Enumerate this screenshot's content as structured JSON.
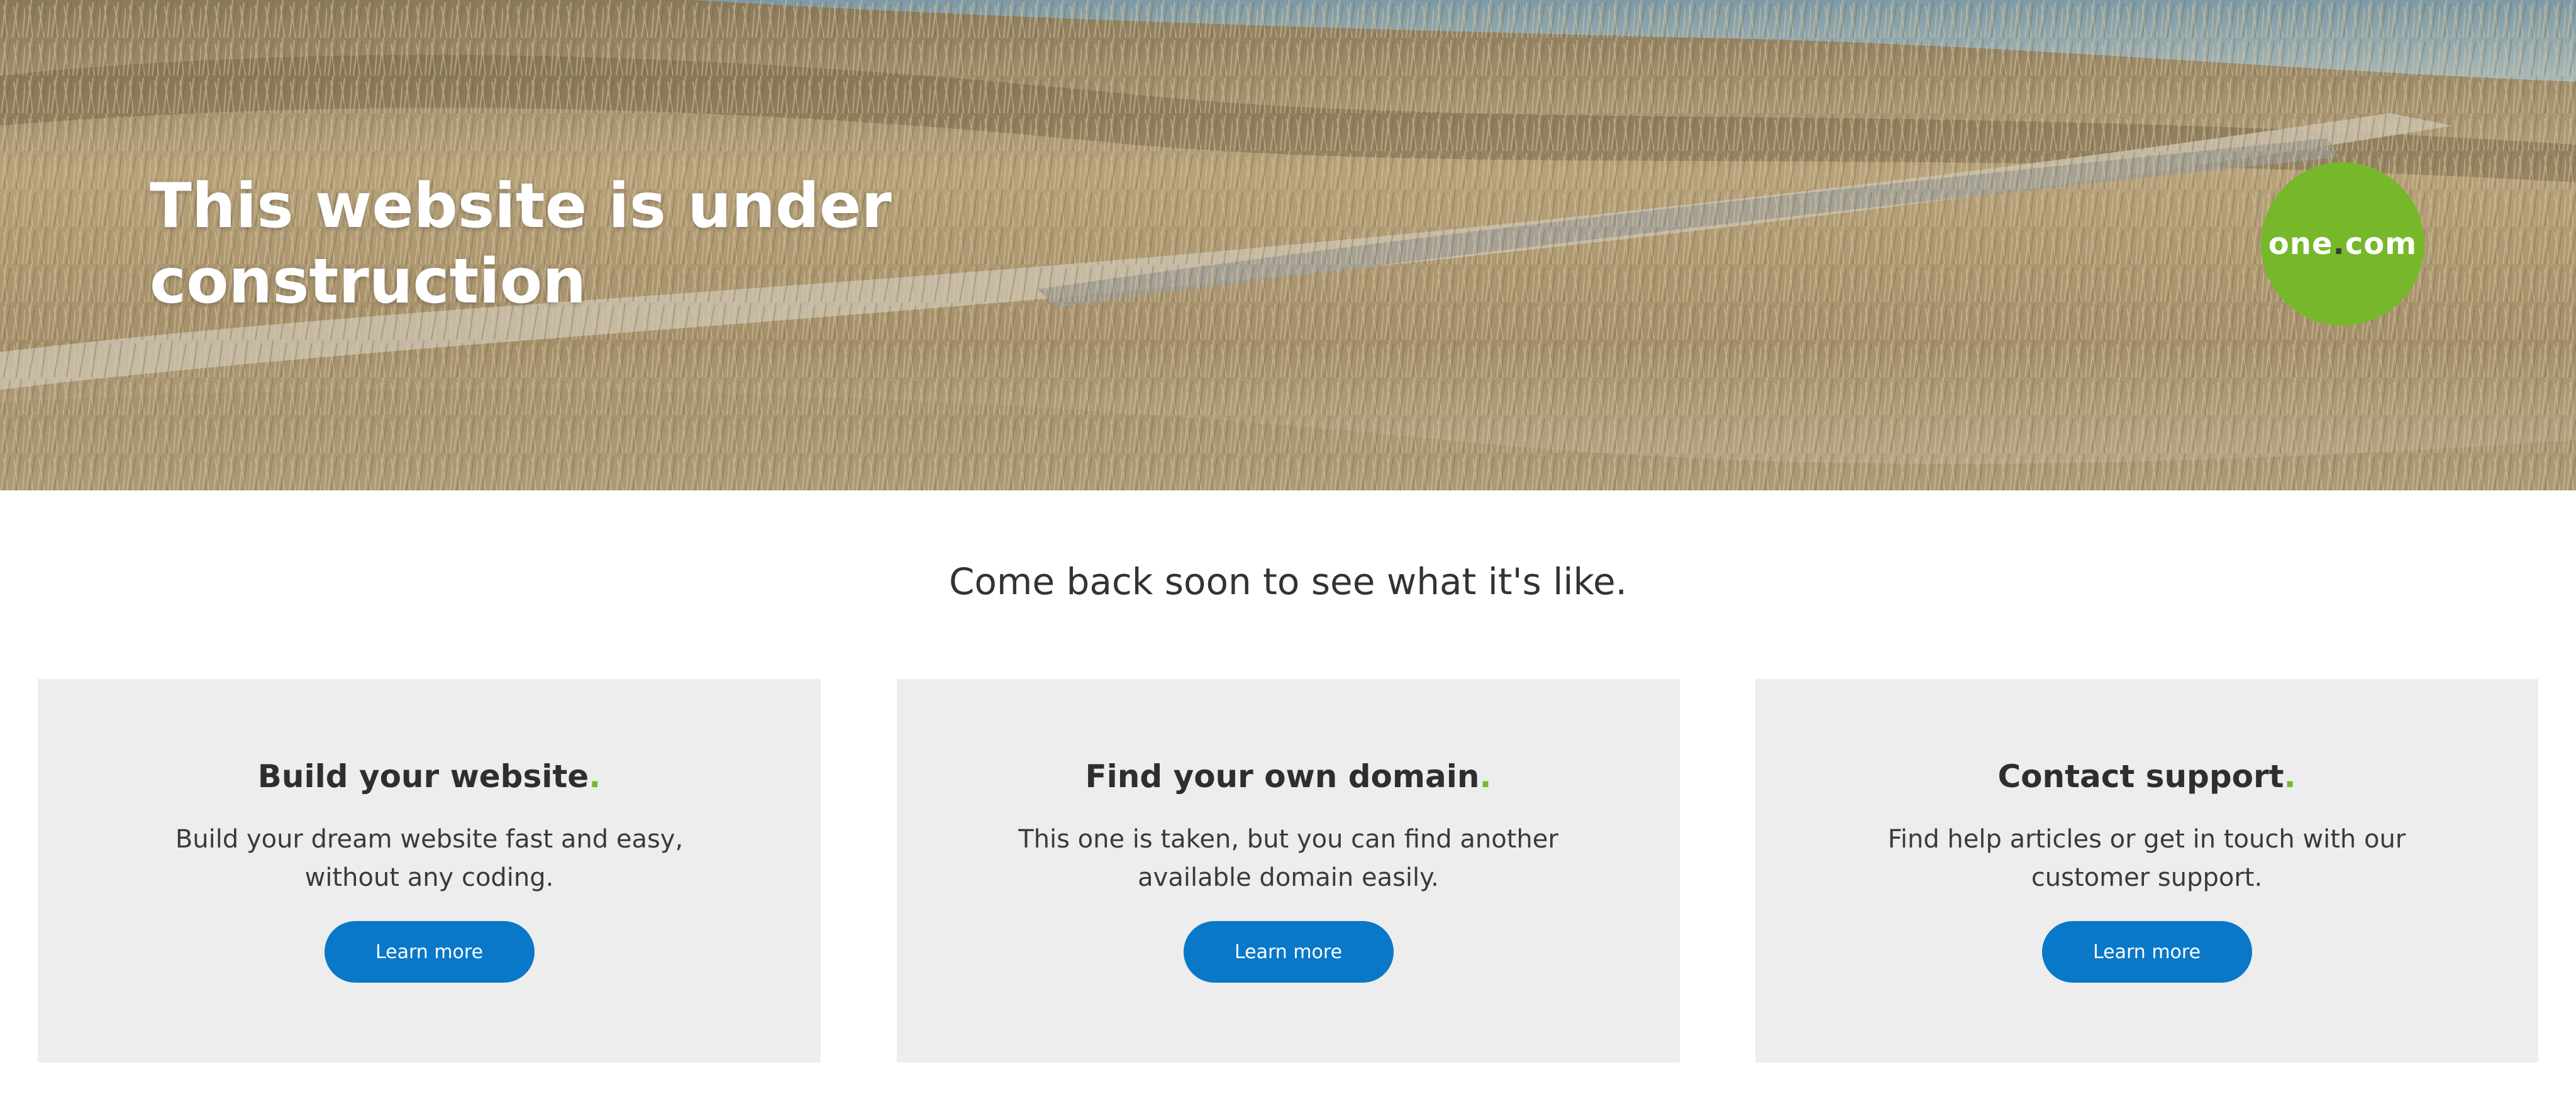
{
  "hero": {
    "title": "This website is under construction"
  },
  "logo": {
    "text_left": "one",
    "text_dot": ".",
    "text_right": "com",
    "color": "#76b82a"
  },
  "tagline": "Come back soon to see what it's like.",
  "cards": [
    {
      "title": "Build your website",
      "accent": ".",
      "description": "Build your dream website fast and easy, without any coding.",
      "button_label": "Learn more"
    },
    {
      "title": "Find your own domain",
      "accent": ".",
      "description": "This one is taken, but you can find another available domain easily.",
      "button_label": "Learn more"
    },
    {
      "title": "Contact support",
      "accent": ".",
      "description": "Find help articles or get in touch with our customer support.",
      "button_label": "Learn more"
    }
  ],
  "colors": {
    "accent_green": "#76b82a",
    "button_blue": "#0a78c8",
    "card_bg": "#ededed"
  }
}
